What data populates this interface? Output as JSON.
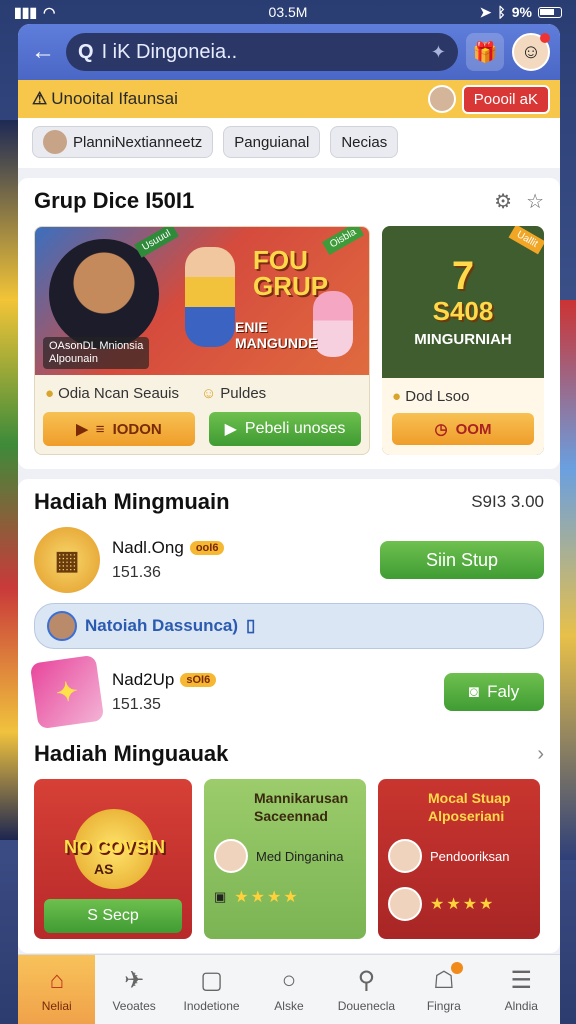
{
  "status_bar": {
    "time": "03.5M",
    "battery": "9%"
  },
  "topbar": {
    "search_text": "I iK Dingoneia.."
  },
  "notice": {
    "text": "Unooital Ifaunsai",
    "action_label": "Poooil aK"
  },
  "chips": [
    "PlanniNextianneetz",
    "Panguianal",
    "Necias"
  ],
  "group_section": {
    "title": "Grup Dice I50I1",
    "promo": {
      "banner_big": "FOU GRUP",
      "banner_sub1": "ENIE",
      "banner_sub2": "MANGUNDE",
      "caption_line1": "OAsonDL Mnionsia",
      "caption_line2": "Alpounain",
      "ribbon_left": "Usuuul",
      "ribbon_right": "Oisbla",
      "meta1": "Odia Ncan Seauis",
      "meta2": "Puldes",
      "btn1": "IODON",
      "btn2": "Pebeli unoses"
    },
    "side": {
      "ribbon": "Uallit",
      "number": "7",
      "amount": "S408",
      "label": "MINGURNIAH",
      "meta": "Dod Lsoo",
      "btn": "OOM"
    }
  },
  "weekly": {
    "title": "Hadiah Mingmuain",
    "count": "S9I3 3.00",
    "rewards": [
      {
        "name": "Nadl.Ong",
        "badge": "ooI6",
        "value": "151.36",
        "action": "Siin Stup",
        "icon": "grid-coin-icon"
      },
      {
        "name": "Nad2Up",
        "badge": "sOI6",
        "value": "151.35",
        "action": "Faly",
        "icon": "card-icon"
      }
    ],
    "info_strip": "Natoiah Dassunca)"
  },
  "weekly2": {
    "title": "Hadiah Minguauak",
    "cards": [
      {
        "coin_text": "NO COVSIN",
        "coin_sub": "AS",
        "button": "S Secp"
      },
      {
        "title1": "Mannikarusan",
        "title2": "Saceennad",
        "row_label": "Med Dinganina"
      },
      {
        "title1": "Mocal Stuap",
        "title2": "Alposeriani",
        "row_label": "Pendooriksan"
      }
    ]
  },
  "nav": [
    {
      "label": "Neliai",
      "icon": "home-icon"
    },
    {
      "label": "Veoates",
      "icon": "rocket-icon"
    },
    {
      "label": "Inodetione",
      "icon": "document-icon"
    },
    {
      "label": "Alske",
      "icon": "circle-icon"
    },
    {
      "label": "Douenecla",
      "icon": "user-icon"
    },
    {
      "label": "Fingra",
      "icon": "chat-icon"
    },
    {
      "label": "Alndia",
      "icon": "menu-icon"
    }
  ],
  "colors": {
    "accent_blue": "#4a67c6",
    "notice_yellow": "#f7c74b",
    "green": "#3f9b33",
    "orange": "#ef9d2a"
  }
}
